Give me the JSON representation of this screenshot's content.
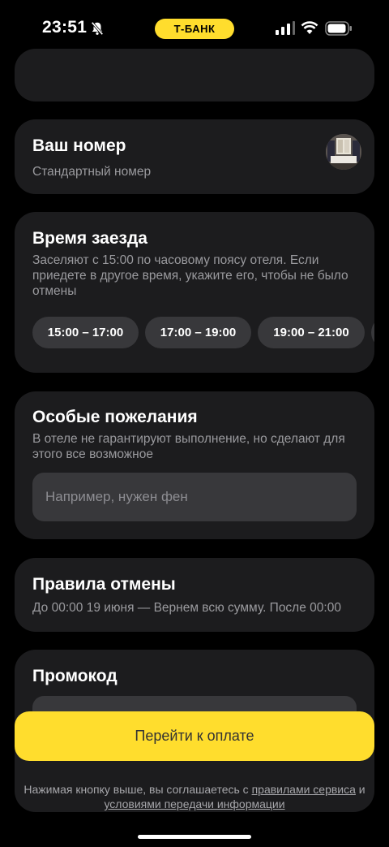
{
  "status_bar": {
    "time": "23:51",
    "bank_label": "Т-БАНК",
    "icons": [
      "bell-slash-icon",
      "signal-icon",
      "wifi-icon",
      "battery-icon"
    ]
  },
  "nav": {
    "back_icon": "chevron-left-icon"
  },
  "room": {
    "title": "Ваш номер",
    "subtitle": "Стандартный номер",
    "thumb_icon": "room-photo"
  },
  "checkin": {
    "title": "Время заезда",
    "description": "Заселяют с 15:00 по часовому поясу отеля. Если приедете в другое время, укажите его, чтобы не было отмены",
    "slots": [
      {
        "label": "15:00 – 17:00"
      },
      {
        "label": "17:00 – 19:00"
      },
      {
        "label": "19:00 – 21:00"
      }
    ]
  },
  "wishes": {
    "title": "Особые пожелания",
    "description": "В отеле не гарантируют выполнение, но сделают для этого все возможное",
    "placeholder": "Например, нужен фен"
  },
  "cancellation": {
    "title": "Правила отмены",
    "text": "До 00:00 19 июня — Вернем всю сумму. После 00:00"
  },
  "promo": {
    "title": "Промокод"
  },
  "pay_button": {
    "label": "Перейти к оплате"
  },
  "footer": {
    "text_before": "Нажимая кнопку выше, вы соглашаетесь с",
    "link_rules": "правилами сервиса",
    "text_and": "и",
    "link_terms": "условиями передачи информации"
  },
  "colors": {
    "background": "#000000",
    "card": "#1c1c1e",
    "chip": "#38383b",
    "accent": "#ffdd2d",
    "back_link": "#3b82f6"
  }
}
